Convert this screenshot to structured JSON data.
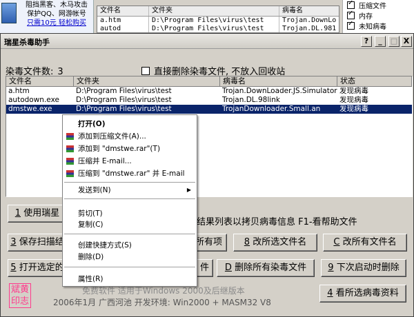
{
  "background_app": {
    "ad_lines": [
      "阻挡黑客、木马攻击",
      "保护QQ、网游帐号"
    ],
    "ad_link": "只需10元 轻松购买",
    "columns": [
      "文件名",
      "文件夹",
      "病毒名"
    ],
    "rows": [
      [
        "a.htm",
        "D:\\Program Files\\virus\\test",
        "Trojan.DownLo"
      ],
      [
        "autod",
        "D:\\Program Files\\virus\\test",
        "Trojan.DL.981"
      ]
    ],
    "checks": [
      "压缩文件",
      "内存",
      "未知病毒"
    ]
  },
  "window": {
    "title": "瑞星杀毒助手",
    "controls": {
      "help": "?",
      "minimize": "_",
      "maximize": "□",
      "close": "X"
    }
  },
  "count": {
    "label": "染毒文件数:",
    "value": "3"
  },
  "delete_option": "直接删除染毒文件, 不放入回收站",
  "table": {
    "columns": [
      "文件名",
      "文件夹",
      "病毒名",
      "状态"
    ],
    "rows": [
      {
        "name": "a.htm",
        "folder": "D:\\Program Files\\virus\\test",
        "virus": "Trojan.DownLoader.JS.Simulator",
        "status": "发现病毒"
      },
      {
        "name": "autodown.exe",
        "folder": "D:\\Program Files\\virus\\test",
        "virus": "Trojan.DL.98link",
        "status": "发现病毒"
      },
      {
        "name": "dmstwe.exe",
        "folder": "D:\\Program Files\\virus\\test",
        "virus": "TrojanDownloader.Small.an",
        "status": "发现病毒"
      }
    ]
  },
  "buttons": {
    "use": {
      "key": "1",
      "text": " 使用瑞星"
    },
    "hint": "查杀结果列表以拷贝病毒信息  F1-看帮助文件",
    "save": {
      "key": "3",
      "text": " 保存扫描结"
    },
    "all_items": {
      "key": "",
      "text": "所有项"
    },
    "rename_sel": {
      "key": "8",
      "text": " 改所选文件名"
    },
    "rename_all": {
      "key": "C",
      "text": " 改所有文件名"
    },
    "open": {
      "key": "5",
      "text": " 打开选定的"
    },
    "file": {
      "key": "",
      "text": "件"
    },
    "delete_all": {
      "key": "D",
      "text": " 删除所有染毒文件"
    },
    "delete_boot": {
      "key": "9",
      "text": " 下次启动时删除"
    },
    "view_info": {
      "key": "4",
      "text": " 看所选病毒资料"
    }
  },
  "stamp": [
    "斌黄",
    "印志"
  ],
  "footer": {
    "line1": "免费软件 适用于Windows 2000及后继版本",
    "line2": "2006年1月 广西河池 开发环境: Win2000 + MASM32 V8"
  },
  "context_menu": {
    "items": [
      {
        "label": "打开(O)",
        "bold": true
      },
      {
        "label": "添加到压缩文件(A)...",
        "icon": "rar-icon"
      },
      {
        "label": "添加到 \"dmstwe.rar\"(T)",
        "icon": "rar-icon"
      },
      {
        "label": "压缩并 E-mail...",
        "icon": "rar-icon"
      },
      {
        "label": "压缩到 \"dmstwe.rar\" 并 E-mail",
        "icon": "rar-icon"
      },
      {
        "label": "发送到(N)",
        "submenu": "▶"
      },
      {
        "label": "剪切(T)"
      },
      {
        "label": "复制(C)"
      },
      {
        "label": "创建快捷方式(S)"
      },
      {
        "label": "删除(D)"
      },
      {
        "label": "属性(R)"
      }
    ]
  }
}
